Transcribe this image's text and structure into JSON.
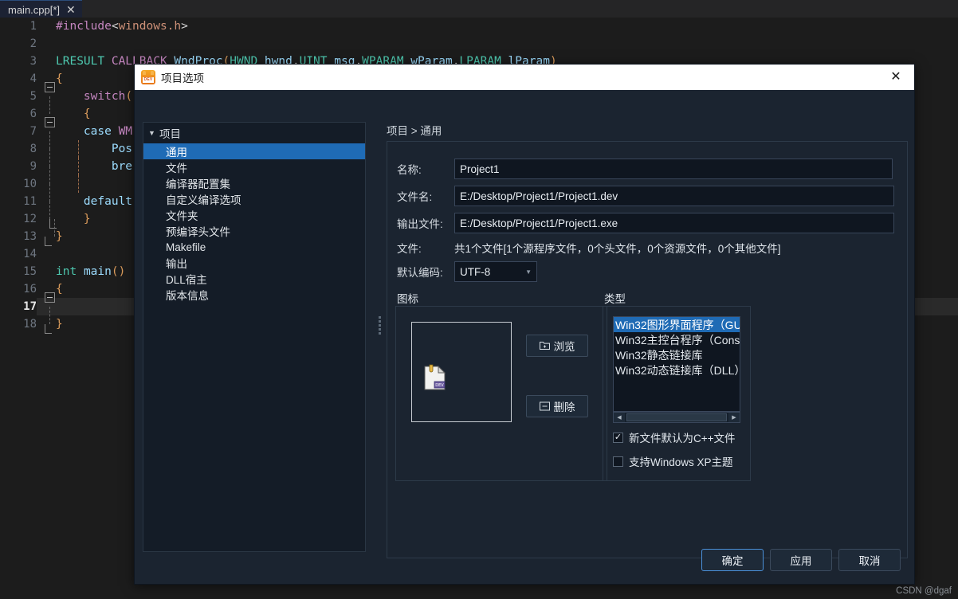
{
  "editor": {
    "tab": {
      "label": "main.cpp[*]",
      "close_icon": "close-icon"
    },
    "lines": [
      {
        "n": "1",
        "text": "#include<windows.h>"
      },
      {
        "n": "2",
        "text": ""
      },
      {
        "n": "3",
        "text": "LRESULT CALLBACK WndProc(HWND hwnd,UINT msg,WPARAM wParam,LPARAM lParam)"
      },
      {
        "n": "4",
        "text": "{"
      },
      {
        "n": "5",
        "text": "    switch("
      },
      {
        "n": "6",
        "text": "    {"
      },
      {
        "n": "7",
        "text": "    case WM"
      },
      {
        "n": "8",
        "text": "        Pos"
      },
      {
        "n": "9",
        "text": "        bre"
      },
      {
        "n": "10",
        "text": ""
      },
      {
        "n": "11",
        "text": "    default"
      },
      {
        "n": "12",
        "text": "    }"
      },
      {
        "n": "13",
        "text": "}"
      },
      {
        "n": "14",
        "text": ""
      },
      {
        "n": "15",
        "text": "int main()"
      },
      {
        "n": "16",
        "text": "{"
      },
      {
        "n": "17",
        "text": ""
      },
      {
        "n": "18",
        "text": "}"
      }
    ]
  },
  "dialog": {
    "title": "项目选项",
    "app_icon": "dev-cpp-icon",
    "app_icon_badge": "DEV",
    "close_icon": "close-icon",
    "tree": {
      "root": "项目",
      "caret_icon": "chevron-down-icon",
      "items": [
        "通用",
        "文件",
        "编译器配置集",
        "自定义编译选项",
        "文件夹",
        "预编译头文件",
        "Makefile",
        "输出",
        "DLL宿主",
        "版本信息"
      ],
      "selected_index": 0
    },
    "breadcrumb": "项目 > 通用",
    "form": {
      "name_label": "名称:",
      "name_value": "Project1",
      "filename_label": "文件名:",
      "filename_value": "E:/Desktop/Project1/Project1.dev",
      "outfile_label": "输出文件:",
      "outfile_value": "E:/Desktop/Project1/Project1.exe",
      "files_label": "文件:",
      "files_value": "共1个文件[1个源程序文件，0个头文件，0个资源文件，0个其他文件]",
      "encoding_label": "默认编码:",
      "encoding_value": "UTF-8",
      "encoding_arrow_icon": "chevron-down-icon"
    },
    "icon_group": {
      "title": "图标",
      "preview_icon": "dev-project-file-icon",
      "browse_label": "浏览",
      "browse_icon": "folder-plus-icon",
      "delete_label": "删除",
      "delete_icon": "minus-box-icon"
    },
    "type_group": {
      "title": "类型",
      "options": [
        "Win32图形界面程序（GU",
        "Win32主控台程序（Cons",
        "Win32静态链接库",
        "Win32动态链接库（DLL）"
      ],
      "selected_index": 0,
      "scroll_left_icon": "triangle-left-icon",
      "scroll_right_icon": "triangle-right-icon",
      "checkbox_cpp_label": "新文件默认为C++文件",
      "checkbox_cpp_checked": true,
      "checkbox_cpp_mark": "✓",
      "checkbox_xp_label": "支持Windows XP主题",
      "checkbox_xp_checked": false
    },
    "footer": {
      "ok_label": "确定",
      "apply_label": "应用",
      "cancel_label": "取消"
    }
  },
  "watermark": "CSDN @dgaf",
  "colors": {
    "accent": "#1f6bb5",
    "dialog_bg": "#1b2430",
    "titlebar_bg": "#ffffff",
    "editor_bg": "#1c1c1c",
    "focus_border": "#4a90d9"
  }
}
